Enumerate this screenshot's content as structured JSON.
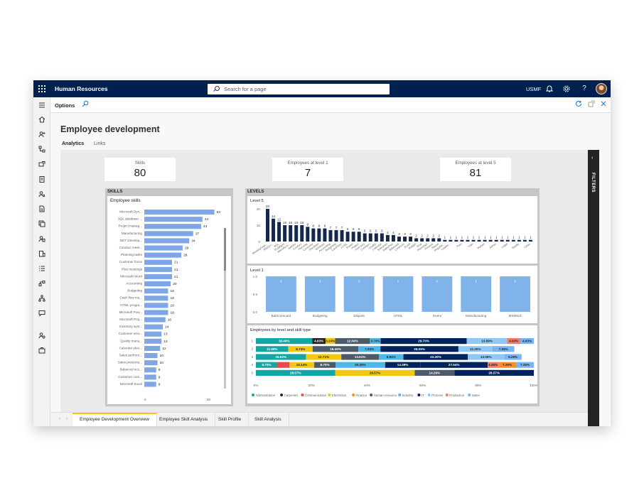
{
  "topbar": {
    "app_name": "Human Resources",
    "search_placeholder": "Search for a page",
    "company": "USMF",
    "icons": [
      "waffle-icon",
      "search-icon",
      "bell-icon",
      "gear-icon",
      "help-icon",
      "avatar"
    ]
  },
  "actionbar": {
    "options_label": "Options"
  },
  "page": {
    "title": "Employee development",
    "tabs": [
      {
        "label": "Analytics",
        "active": true
      },
      {
        "label": "Links",
        "active": false
      }
    ]
  },
  "filters_label": "FILTERS",
  "cards": [
    {
      "label": "Skills",
      "value": "80"
    },
    {
      "label": "Employees at level 1",
      "value": "7"
    },
    {
      "label": "Employees at level 5",
      "value": "81"
    }
  ],
  "skills_panel": {
    "header": "SKILLS",
    "title": "Employee skills"
  },
  "levels_panel": {
    "header": "LEVELS"
  },
  "bottom_tabs": [
    {
      "label": "Employee Development Overview",
      "active": true
    },
    {
      "label": "Employee Skill Analysis",
      "active": false
    },
    {
      "label": "Skill Profile",
      "active": false
    },
    {
      "label": "Skill Analysis",
      "active": false
    }
  ],
  "chart_data": [
    {
      "type": "bar",
      "orientation": "horizontal",
      "title": "Employee skills",
      "categories": [
        "Microsoft Dyn...",
        "SQL database ...",
        "Project manag...",
        "Manufacturing",
        ".NET Develop...",
        "Conduct meet...",
        "Planning tasks",
        "Customer focus",
        "Plan meetings",
        "Microsoft Word",
        "Accounting",
        "Budgeting",
        "Cash flow ma...",
        "HTML progra...",
        "Microsoft Pow...",
        "Microsoft Proj...",
        "Inventory syst...",
        "Customer serv...",
        "Quality mana...",
        "Calendar plan...",
        "Sales perform...",
        "Sales presenta...",
        "Balanced sco...",
        "Customer com...",
        "Microsoft Excel"
      ],
      "values": [
        53,
        44,
        43,
        37,
        34,
        29,
        28,
        21,
        21,
        21,
        20,
        18,
        18,
        18,
        18,
        16,
        14,
        13,
        13,
        12,
        10,
        10,
        9,
        9,
        9
      ],
      "xlim": [
        0,
        50
      ],
      "xticks": [
        "0",
        "50"
      ],
      "color": "#7fa7e8"
    },
    {
      "type": "bar",
      "title": "Level 5",
      "values": [
        20,
        14,
        12,
        10,
        10,
        10,
        10,
        9,
        8,
        8,
        8,
        7,
        7,
        7,
        6,
        6,
        6,
        5,
        5,
        5,
        5,
        4,
        4,
        3,
        3,
        3,
        2,
        2,
        2,
        2,
        2,
        1,
        1,
        1,
        1,
        1,
        1,
        1,
        1,
        1,
        1,
        1,
        1,
        1,
        1,
        1,
        1
      ],
      "categories": [
        "MeetingOrga...",
        "MSDyn...",
        "SQL",
        "ProjMgmt",
        "Manufactu...",
        "NetDev",
        "Conduct",
        "Planning",
        "Customer",
        "PlanMeet",
        "MSWord",
        "Accounting",
        "Budgeting",
        "CashFlow",
        "HTML",
        "Power",
        "Project",
        "Inventory",
        "CustServ",
        "Quality",
        "Calendar",
        "SalesPerf",
        "SalesPres",
        "Balanced",
        "CustCom",
        "Excel",
        "Budget",
        "Eval",
        "Planning2",
        "Process",
        "Report",
        "Negotiat...",
        "Leader...",
        "Coaching",
        "Pres",
        "Sales",
        "Train",
        "Team",
        "Market",
        "Finance",
        "Admin",
        "Exec",
        "Legal",
        "Payroll",
        "Supply",
        "Design",
        "Other"
      ],
      "ylim": [
        0,
        20
      ],
      "yticks": [
        "0",
        "10",
        "20"
      ],
      "color": "#14284b"
    },
    {
      "type": "bar",
      "title": "Level 1",
      "categories": [
        "BalScorecard",
        "Budgeting",
        "Dispute",
        "HTML",
        "Invent",
        "Manufacturing",
        "MSWord"
      ],
      "values": [
        1,
        1,
        1,
        1,
        1,
        1,
        1
      ],
      "ylim": [
        0,
        1.0
      ],
      "yticks": [
        "0.0",
        "0.5",
        "1.0"
      ],
      "color": "#7fb3ea"
    },
    {
      "type": "bar",
      "stacked": "100%",
      "orientation": "horizontal",
      "title": "Employees by level and skill type",
      "categories": [
        "1",
        "2",
        "3",
        "4",
        "5"
      ],
      "xticks": [
        "0%",
        "20%",
        "40%",
        "60%",
        "80%",
        "100%"
      ],
      "legend": [
        "Administration",
        "Carpenter",
        "Communication",
        "Electrician",
        "Finance",
        "Human resource",
        "Industry",
        "IT",
        "Process",
        "Production",
        "Sales"
      ],
      "legend_colors": [
        "#12a7a5",
        "#252423",
        "#e74c4c",
        "#f2c811",
        "#fd8b2a",
        "#4d5a6b",
        "#4db8e8",
        "#00235e",
        "#8fc8f5",
        "#f07d6a",
        "#77b6f2"
      ],
      "series": [
        {
          "segments": [
            19.44,
            4.63,
            3.24,
            12.04,
            3.7,
            29.7,
            13.89,
            4.63,
            4.63
          ],
          "labels": [
            "19.44%",
            "4.63%",
            "3.24%",
            "12.04%",
            "3.70%",
            "29.70%",
            "13.89%",
            "4.63%",
            "4.63%"
          ],
          "colors": [
            "#12a7a5",
            "#252423",
            "#f2c811",
            "#4d5a6b",
            "#4db8e8",
            "#00235e",
            "#8fc8f5",
            "#f07d6a",
            "#77b6f2"
          ]
        },
        {
          "segments": [
            11.69,
            8.74,
            16.46,
            7.93,
            28.05,
            12.2,
            7.93,
            7.0
          ],
          "labels": [
            "11.69%",
            "8.74%",
            "16.46%",
            "7.93%",
            "28.05%",
            "12.20%",
            "7.93%",
            ""
          ],
          "colors": [
            "#12a7a5",
            "#f2c811",
            "#4d5a6b",
            "#4db8e8",
            "#00235e",
            "#8fc8f5",
            "#77b6f2",
            "#ffffff"
          ]
        },
        {
          "segments": [
            18.02,
            12.71,
            13.51,
            8.84,
            23.2,
            13.06,
            6.29,
            4.37
          ],
          "labels": [
            "18.02%",
            "12.71%",
            "13.51%",
            "8.84%",
            "23.20%",
            "13.06%",
            "6.29%",
            ""
          ],
          "colors": [
            "#12a7a5",
            "#f2c811",
            "#4d5a6b",
            "#4db8e8",
            "#00235e",
            "#8fc8f5",
            "#77b6f2",
            "#ffffff"
          ]
        },
        {
          "segments": [
            8.7,
            5.0,
            10.14,
            8.7,
            20.29,
            14.38,
            27.54,
            4.35,
            7.25,
            7.25
          ],
          "labels": [
            "8.70%",
            "",
            "10.14%",
            "8.70%",
            "20.29%",
            "14.38%",
            "27.54%",
            "4.35%",
            "7.25%",
            "7.25%"
          ],
          "colors": [
            "#12a7a5",
            "#e74c4c",
            "#f2c811",
            "#4d5a6b",
            "#4db8e8",
            "#00235e",
            "#00235e",
            "#f07d6a",
            "#fd8b2a",
            "#77b6f2"
          ]
        },
        {
          "segments": [
            28.57,
            28.57,
            14.29,
            28.57
          ],
          "labels": [
            "28.57%",
            "28.57%",
            "14.29%",
            "28.57%"
          ],
          "colors": [
            "#12a7a5",
            "#f2c811",
            "#4d5a6b",
            "#00235e"
          ]
        }
      ]
    }
  ]
}
